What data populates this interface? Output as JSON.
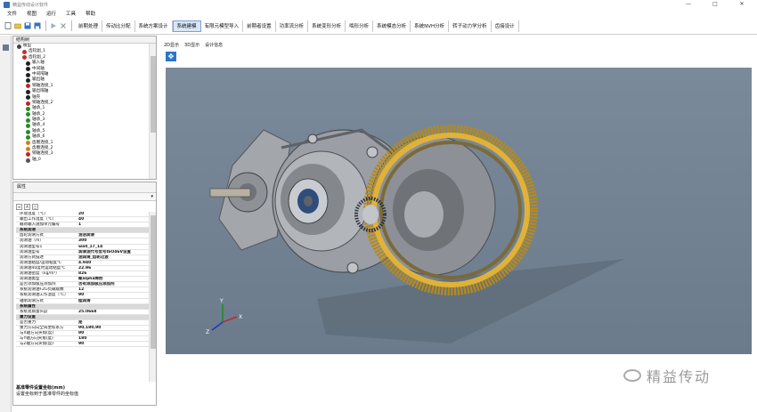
{
  "window": {
    "title": "精益传动设计软件",
    "minimize": "—",
    "maximize": "□",
    "close": "✕"
  },
  "menu": [
    "文件",
    "视图",
    "运行",
    "工具",
    "帮助"
  ],
  "module_tabs": [
    "前期处理",
    "传动比分配",
    "系统方案设计",
    "系统建模",
    "有限元模型导入",
    "前期者设置",
    "功率流分析",
    "系统变形分析",
    "啮形分析",
    "系统模态分析",
    "系统NVH分析",
    "转子动力学分析",
    "齿接设计"
  ],
  "active_tab_index": 3,
  "structure_panel": {
    "title": "结构树"
  },
  "tree": [
    "模型",
    "齿轮副_1",
    "齿轮副_2",
    "输入轴",
    "中间轴",
    "中间隔轴",
    "输出轴",
    "销轴连接_1",
    "输出隔轴",
    "轴壳",
    "销轴连接_2",
    "轴承_1",
    "轴承_2",
    "轴承_3",
    "轴承_4",
    "轴承_5",
    "轴承_6",
    "齿圈连接_1",
    "齿圈连接_2",
    "销轴连接_3",
    "轴_0"
  ],
  "properties_panel": {
    "title": "属性"
  },
  "properties": [
    {
      "k": "环境温度（℃）",
      "v": "20"
    },
    {
      "k": "输出工作温度（℃）",
      "v": "40"
    },
    {
      "k": "载荷输入施加单元编号",
      "v": "1"
    },
    {
      "k": "系统润滑",
      "v": "",
      "group": true
    },
    {
      "k": "齿轮润滑方式",
      "v": "油浴润滑"
    },
    {
      "k": "润滑油（m）",
      "v": "300"
    },
    {
      "k": "润滑油型号1",
      "v": "wall_17_14"
    },
    {
      "k": "润滑油型号",
      "v": "润滑油代号型号ISO46V设置"
    },
    {
      "k": "润滑方式描述",
      "v": "油润滑_齿轮过渡"
    },
    {
      "k": "润滑油粘度/运动粘度℃",
      "v": "4.940"
    },
    {
      "k": "润滑油40度时运动粘度℃",
      "v": "22.96"
    },
    {
      "k": "润滑油密度（kg/m³）",
      "v": "826"
    },
    {
      "k": "润滑油类型",
      "v": "聚alpha烯烃"
    },
    {
      "k": "是否添加极压添加剂",
      "v": "否有添加极压添加剂"
    },
    {
      "k": "系统润滑油FZG负载级数",
      "v": "12"
    },
    {
      "k": "系统润滑油工作温度（℃）",
      "v": "90"
    },
    {
      "k": "轴承润滑方式",
      "v": "脂润滑"
    },
    {
      "k": "系统属性",
      "v": "",
      "group": true
    },
    {
      "k": "系统总质量(kg)",
      "v": "25.0668"
    },
    {
      "k": "重力设置",
      "v": "",
      "group": true
    },
    {
      "k": "是否重力",
      "v": "是"
    },
    {
      "k": "重力方向向全局坐标系方",
      "v": "90,180,90"
    },
    {
      "k": "与X轴方向夹角(度)",
      "v": "90"
    },
    {
      "k": "与Y轴方向夹角(度)",
      "v": "180"
    },
    {
      "k": "与Z轴方向夹角(度)",
      "v": "90"
    }
  ],
  "property_desc": {
    "title": "基准零件设置坐标(mm)",
    "text": "设置坐标到于基准零件的坐标值"
  },
  "viewport_tabs": [
    "2D显示",
    "3D显示",
    "设计信息"
  ],
  "viewport_tool_icon": "fit-view-icon",
  "viewport_bg": "#74849a",
  "gear_color": "#d4a020",
  "watermark": "精益传动"
}
